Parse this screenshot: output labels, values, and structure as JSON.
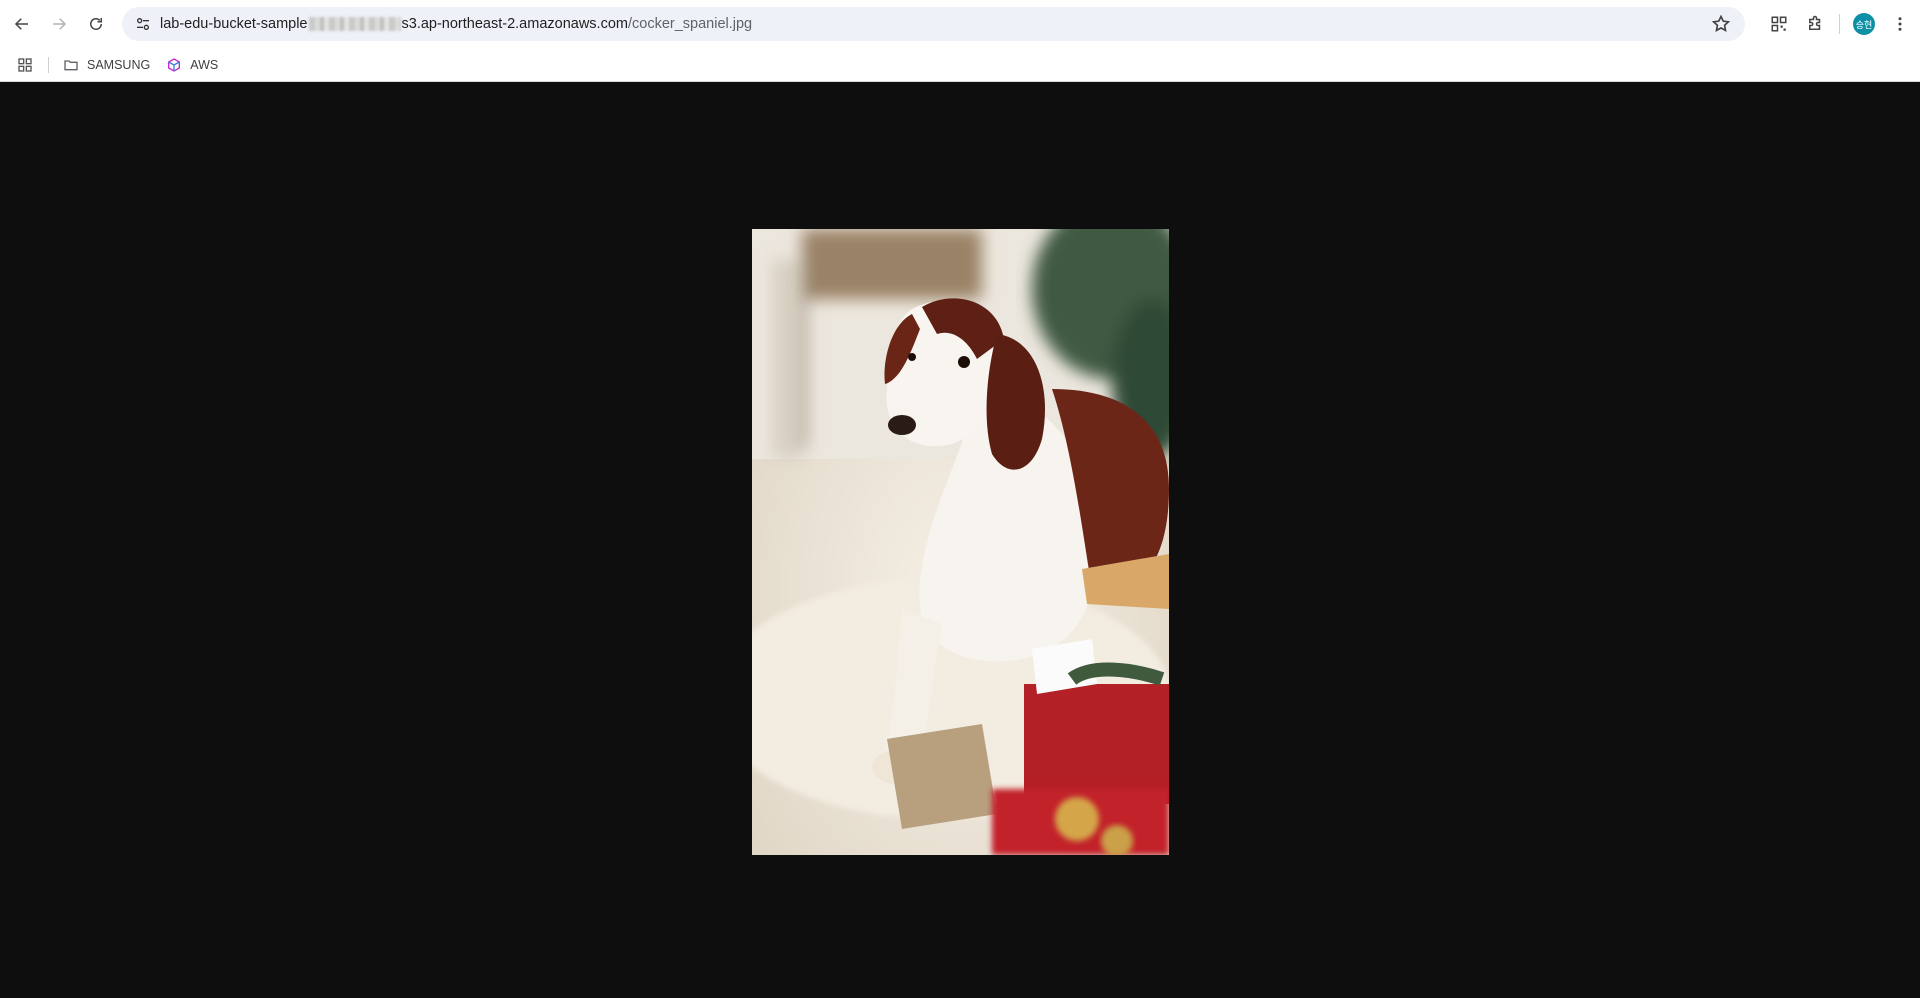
{
  "browser": {
    "url_host_visible_start": "lab-edu-bucket-sample",
    "url_host_visible_end": "s3.ap-northeast-2.amazonaws.com",
    "url_path": "/cocker_spaniel.jpg",
    "profile_initials": "승현"
  },
  "bookmarks": {
    "items": [
      {
        "label": "SAMSUNG",
        "icon": "folder-icon"
      },
      {
        "label": "AWS",
        "icon": "aws-cube-icon"
      }
    ]
  },
  "image": {
    "alt": "cocker_spaniel.jpg"
  },
  "colors": {
    "background": "#0e0e0e",
    "omnibox": "#eef1f8",
    "avatar": "#0d8fa6"
  }
}
